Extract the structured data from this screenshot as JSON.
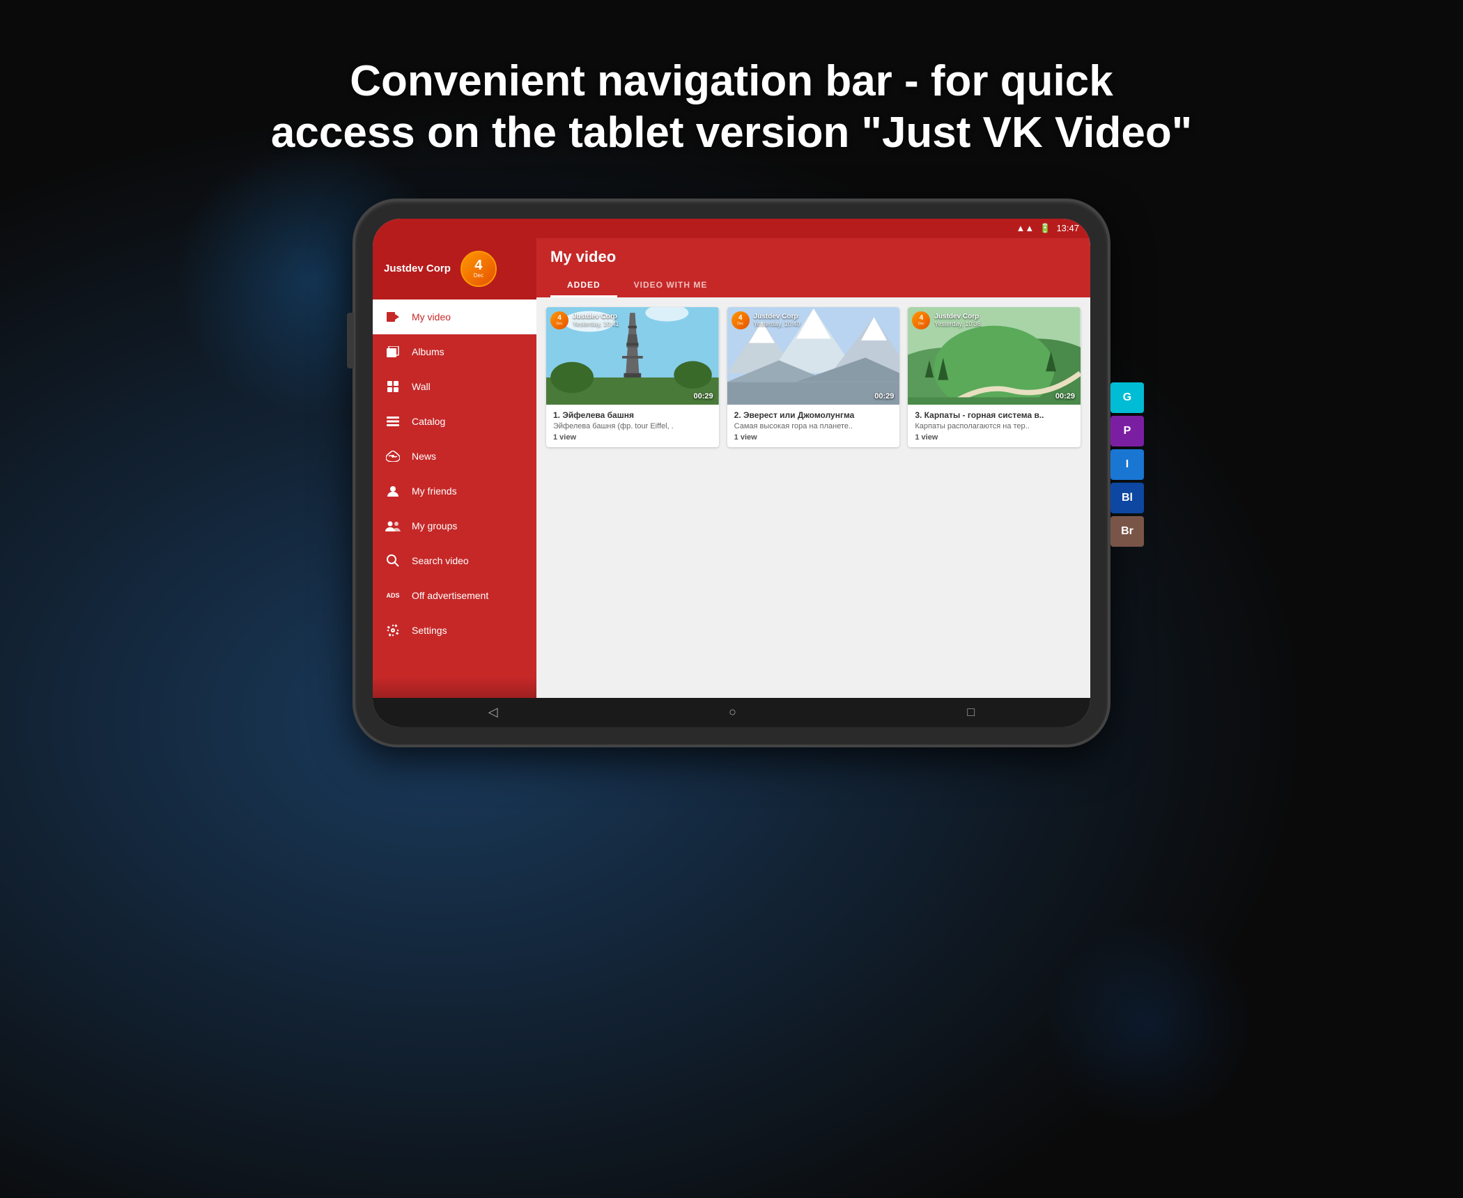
{
  "headline": {
    "line1": "Convenient navigation bar - for quick",
    "line2": "access on the tablet version \"Just VK Video\""
  },
  "statusBar": {
    "time": "13:47",
    "wifiIcon": "wifi",
    "batteryIcon": "battery"
  },
  "sidebar": {
    "username": "Justdev Corp",
    "avatar": {
      "number": "4",
      "month": "Dec"
    },
    "items": [
      {
        "id": "my-video",
        "label": "My video",
        "icon": "▶",
        "active": true
      },
      {
        "id": "albums",
        "label": "Albums",
        "icon": "🖼",
        "active": false
      },
      {
        "id": "wall",
        "label": "Wall",
        "icon": "📋",
        "active": false
      },
      {
        "id": "catalog",
        "label": "Catalog",
        "icon": "📖",
        "active": false
      },
      {
        "id": "news",
        "label": "News",
        "icon": "📡",
        "active": false
      },
      {
        "id": "my-friends",
        "label": "My friends",
        "icon": "👤",
        "active": false
      },
      {
        "id": "my-groups",
        "label": "My groups",
        "icon": "👥",
        "active": false
      },
      {
        "id": "search-video",
        "label": "Search video",
        "icon": "🔍",
        "active": false
      },
      {
        "id": "off-advertisement",
        "label": "Off advertisement",
        "icon": "ADS",
        "active": false
      },
      {
        "id": "settings",
        "label": "Settings",
        "icon": "⚙",
        "active": false
      }
    ]
  },
  "mainContent": {
    "title": "My video",
    "tabs": [
      {
        "id": "added",
        "label": "ADDED",
        "active": true
      },
      {
        "id": "video-with-me",
        "label": "VIDEO WITH ME",
        "active": false
      }
    ],
    "videos": [
      {
        "id": "video-1",
        "user": "Justdev Corp",
        "date": "Yesterday, 10:41",
        "duration": "00:29",
        "title": "1. Эйфелева башня",
        "desc": "Эйфелева башня (фр. tour Eiffel, .",
        "views": "1 view",
        "thumbnailType": "eiffel"
      },
      {
        "id": "video-2",
        "user": "Justdev Corp",
        "date": "Yesterday, 10:40",
        "duration": "00:29",
        "title": "2. Эверест или Джомолунгма",
        "desc": "Самая высокая гора на планете..",
        "views": "1 view",
        "thumbnailType": "everest"
      },
      {
        "id": "video-3",
        "user": "Justdev Corp",
        "date": "Yesterday, 10:36",
        "duration": "00:29",
        "title": "3. Карпаты - горная система в..",
        "desc": "Карпаты располагаются на тер..",
        "views": "1 view",
        "thumbnailType": "karpaty"
      }
    ]
  },
  "bottomNav": {
    "backIcon": "◁",
    "homeIcon": "○",
    "recentIcon": "□"
  },
  "rightTabs": [
    {
      "id": "g-tab",
      "label": "G",
      "color": "#00bcd4"
    },
    {
      "id": "p-tab",
      "label": "P",
      "color": "#7b1fa2"
    },
    {
      "id": "i-tab",
      "label": "I",
      "color": "#1976d2"
    },
    {
      "id": "bl-tab",
      "label": "Bl",
      "color": "#0d47a1"
    },
    {
      "id": "br-tab",
      "label": "Br",
      "color": "#795548"
    }
  ],
  "avatarNumber": "4",
  "avatarMonth": "Dec"
}
